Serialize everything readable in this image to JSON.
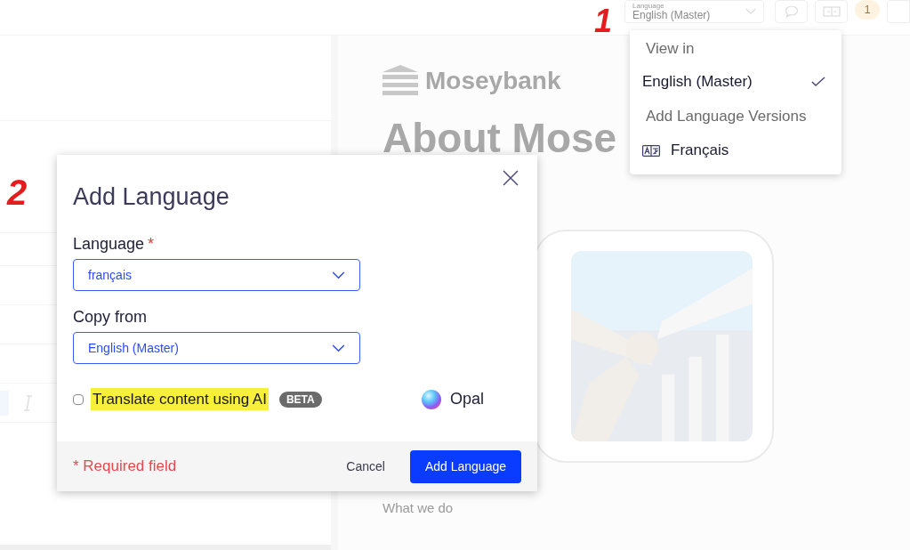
{
  "header": {
    "language_select": {
      "label": "Language",
      "value": "English (Master)"
    },
    "notification_badge": "1"
  },
  "language_menu": {
    "heading": "View in",
    "items": [
      {
        "label": "English (Master)",
        "selected": true
      }
    ],
    "section": "Add Language Versions",
    "versions": [
      {
        "label": "Français"
      }
    ]
  },
  "page": {
    "logo": "Moseybank",
    "heading": "About Mose",
    "subheading": "What we do"
  },
  "dialog": {
    "title": "Add Language",
    "required_mark": "*",
    "fields": [
      {
        "label": "Language",
        "required": true,
        "value": "français"
      },
      {
        "label": "Copy from",
        "required": false,
        "value": "English (Master)"
      }
    ],
    "translate_option": {
      "label": "Translate content using AI",
      "checked": false,
      "highlighted": true,
      "badge": "BETA"
    },
    "assistant": "Opal",
    "required_note": "* Required field",
    "buttons": [
      {
        "label": "Cancel",
        "kind": "secondary"
      },
      {
        "label": "Add Language",
        "kind": "primary"
      }
    ]
  },
  "annotations": [
    "1",
    "2"
  ]
}
